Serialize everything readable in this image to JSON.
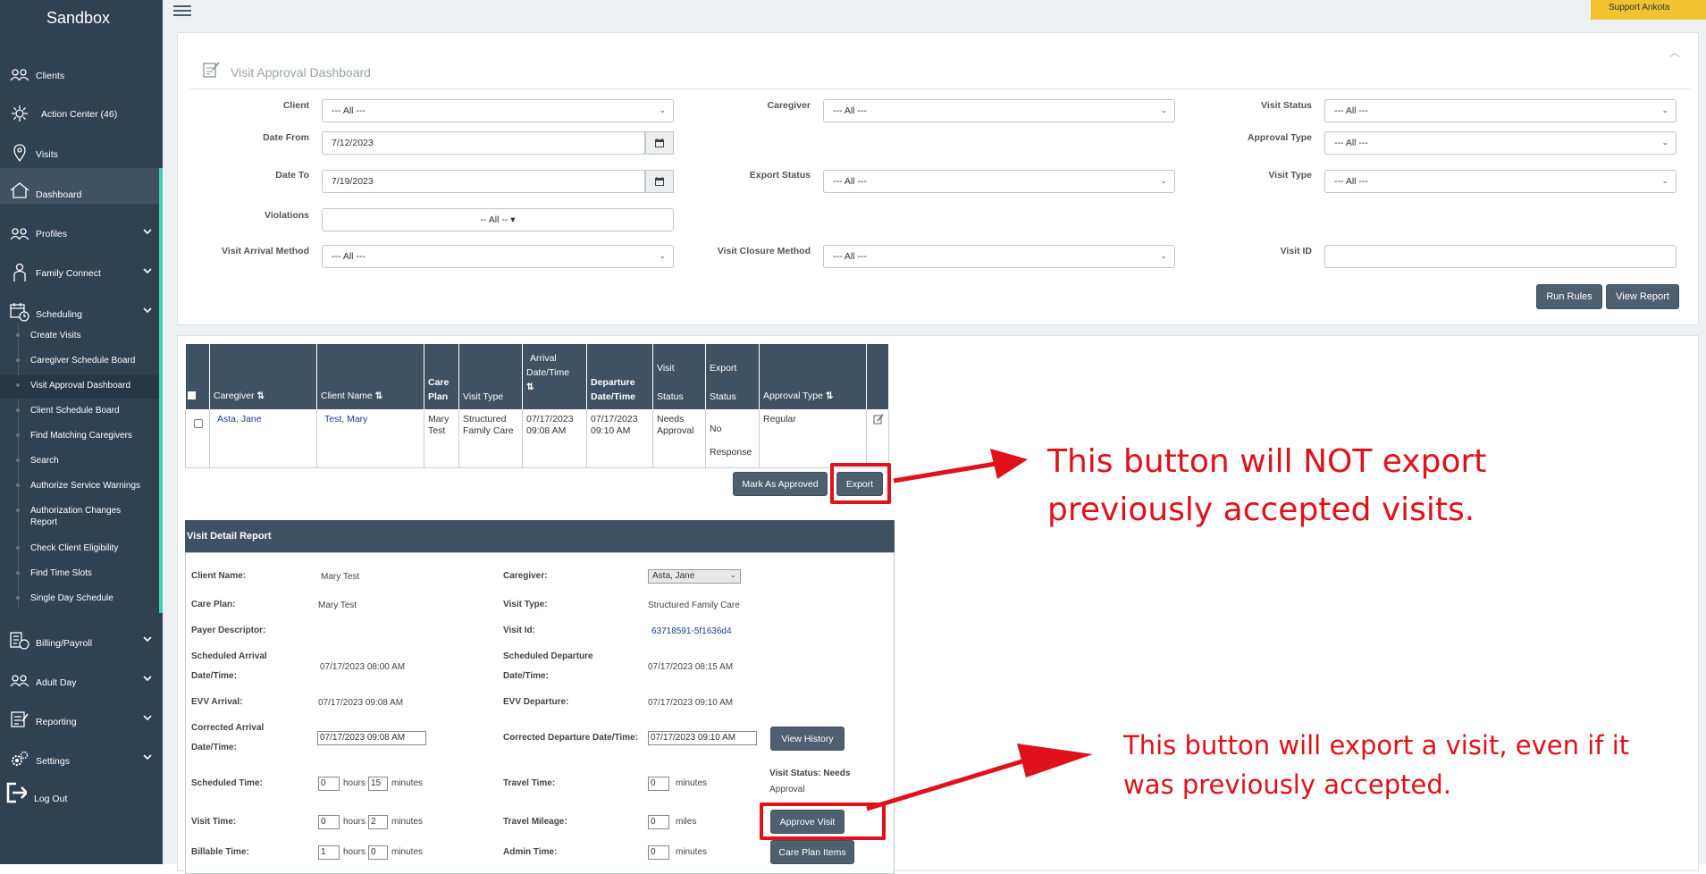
{
  "brand": "Sandbox",
  "support": "Support Ankota",
  "nav": {
    "clients": "Clients",
    "action_center": "Action Center (46)",
    "visits": "Visits",
    "dashboard": "Dashboard",
    "profiles": "Profiles",
    "family_connect": "Family Connect",
    "scheduling": "Scheduling",
    "billing": "Billing/Payroll",
    "adult_day": "Adult Day",
    "reporting": "Reporting",
    "settings": "Settings",
    "logout": "Log Out"
  },
  "scheduling_items": [
    "Create Visits",
    "Caregiver Schedule Board",
    "Visit Approval Dashboard",
    "Client Schedule Board",
    "Find Matching Caregivers",
    "Search",
    "Authorize Service Warnings",
    "Authorization Changes Report",
    "Check Client Eligibility",
    "Find Time Slots",
    "Single Day Schedule"
  ],
  "panel_title": "Visit Approval Dashboard",
  "filters": {
    "client_label": "Client",
    "client_value": "--- All ---",
    "caregiver_label": "Caregiver",
    "caregiver_value": "--- All ---",
    "visit_status_label": "Visit Status",
    "visit_status_value": "--- All ---",
    "date_from_label": "Date From",
    "date_from_value": "7/12/2023",
    "approval_type_label": "Approval Type",
    "approval_type_value": "--- All ---",
    "date_to_label": "Date To",
    "date_to_value": "7/19/2023",
    "export_status_label": "Export Status",
    "export_status_value": "--- All ---",
    "visit_type_label": "Visit Type",
    "visit_type_value": "--- All ---",
    "violations_label": "Violations",
    "violations_value": "-- All -- ▾",
    "arrival_method_label": "Visit Arrival Method",
    "arrival_method_value": "--- All ---",
    "closure_method_label": "Visit Closure Method",
    "closure_method_value": "--- All ---",
    "visit_id_label": "Visit ID",
    "visit_id_value": ""
  },
  "buttons": {
    "run_rules": "Run Rules",
    "view_report": "View Report",
    "mark_approved": "Mark As Approved",
    "export": "Export",
    "view_history": "View History",
    "approve_visit": "Approve Visit",
    "care_plan_items": "Care Plan Items"
  },
  "table": {
    "headers": {
      "caregiver": "Caregiver",
      "client_name": "Client Name",
      "care_plan_1": "Care",
      "care_plan_2": "Plan",
      "visit_type": "Visit Type",
      "arrival_1": "Arrival",
      "arrival_2": "Date/Time",
      "departure_1": "Departure",
      "departure_2": "Date/Time",
      "visit_status_1": "Visit",
      "visit_status_2": "Status",
      "export_status_1": "Export",
      "export_status_2": "Status",
      "approval_type": "Approval Type"
    },
    "row": {
      "caregiver": "Asta, Jane",
      "client": "Test, Mary",
      "care_plan_1": "Mary",
      "care_plan_2": "Test",
      "visit_type_1": "Structured",
      "visit_type_2": "Family Care",
      "arrival_1": "07/17/2023",
      "arrival_2": "09:08 AM",
      "departure_1": "07/17/2023",
      "departure_2": "09:10 AM",
      "status_1": "Needs",
      "status_2": "Approval",
      "export_1": "No",
      "export_2": "Response",
      "approval_type": "Regular"
    }
  },
  "detail": {
    "header": "Visit Detail Report",
    "client_name_label": "Client Name:",
    "client_name": "Mary Test",
    "caregiver_label": "Caregiver:",
    "caregiver": "Asta, Jane",
    "care_plan_label": "Care Plan:",
    "care_plan": "Mary Test",
    "visit_type_label": "Visit Type:",
    "visit_type": "Structured Family Care",
    "payer_label": "Payer Descriptor:",
    "visit_id_label": "Visit Id:",
    "visit_id": "63718591-5f1636d4",
    "sched_arrival_label_1": "Scheduled Arrival",
    "sched_arrival_label_2": "Date/Time:",
    "sched_arrival": "07/17/2023 08:00 AM",
    "sched_departure_label_1": "Scheduled Departure",
    "sched_departure_label_2": "Date/Time:",
    "sched_departure": "07/17/2023 08:15 AM",
    "evv_arrival_label": "EVV Arrival:",
    "evv_arrival": "07/17/2023 09:08 AM",
    "evv_departure_label": "EVV Departure:",
    "evv_departure": "07/17/2023 09:10 AM",
    "corr_arrival_label_1": "Corrected Arrival",
    "corr_arrival_label_2": "Date/Time:",
    "corr_arrival": "07/17/2023 09:08 AM",
    "corr_departure_label": "Corrected Departure Date/Time:",
    "corr_departure": "07/17/2023 09:10 AM",
    "visit_status_1": "Visit Status: Needs",
    "visit_status_2": "Approval",
    "sched_time_label": "Scheduled Time:",
    "sched_hours": "0",
    "sched_minutes": "15",
    "travel_time_label": "Travel Time:",
    "travel_time": "0",
    "visit_time_label": "Visit Time:",
    "visit_hours": "0",
    "visit_minutes": "2",
    "travel_mileage_label": "Travel Mileage:",
    "travel_mileage": "0",
    "billable_label": "Billable Time:",
    "billable_hours": "1",
    "billable_minutes": "0",
    "admin_label": "Admin Time:",
    "admin_time": "0",
    "hours": "hours",
    "minutes": "minutes",
    "miles": "miles"
  },
  "annotations": {
    "export_1": "This button will NOT export",
    "export_2": "previously accepted visits.",
    "approve_1": "This button will export a visit, even if it",
    "approve_2": "was previously accepted."
  },
  "colors": {
    "sidebar": "#2f4252",
    "accent": "#3fd2b0",
    "button": "#4e6070",
    "annotation": "#e0111a"
  }
}
